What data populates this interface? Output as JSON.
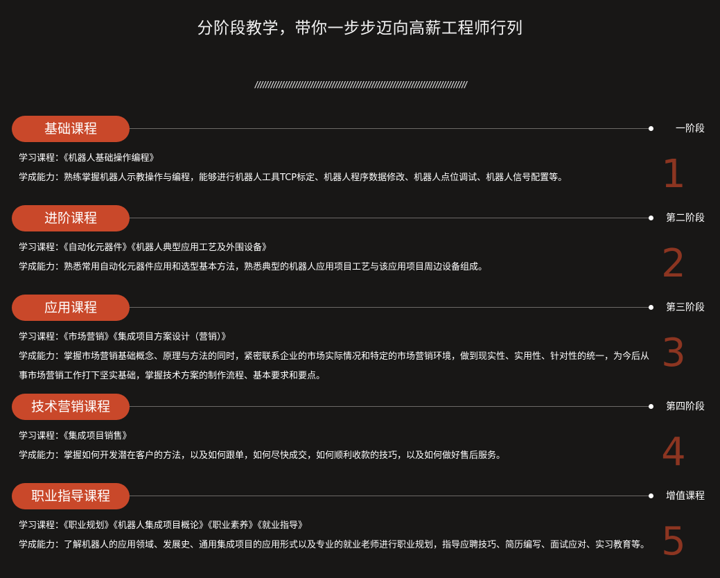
{
  "header": {
    "title": "分阶段教学，带你一步步迈向高薪工程师行列",
    "divider": "////////////////////////////////////////////////////////////////////////////////"
  },
  "labels": {
    "course": "学习课程：",
    "ability": "学成能力："
  },
  "stages": [
    {
      "name": "基础课程",
      "stage": "一阶段",
      "number": "1",
      "courses": "《机器人基础操作编程》",
      "ability": "熟练掌握机器人示教操作与编程，能够进行机器人工具TCP标定、机器人程序数据修改、机器人点位调试、机器人信号配置等。"
    },
    {
      "name": "进阶课程",
      "stage": "第二阶段",
      "number": "2",
      "courses": "《自动化元器件》《机器人典型应用工艺及外围设备》",
      "ability": "熟悉常用自动化元器件应用和选型基本方法，熟悉典型的机器人应用项目工艺与该应用项目周边设备组成。"
    },
    {
      "name": "应用课程",
      "stage": "第三阶段",
      "number": "3",
      "courses": "《市场营销》《集成项目方案设计（营销）》",
      "ability": "掌握市场营销基础概念、原理与方法的同时，紧密联系企业的市场实际情况和特定的市场营销环境，做到现实性、实用性、针对性的统一，为今后从事市场营销工作打下坚实基础，掌握技术方案的制作流程、基本要求和要点。"
    },
    {
      "name": "技术营销课程",
      "stage": "第四阶段",
      "number": "4",
      "courses": "《集成项目销售》",
      "ability": "掌握如何开发潜在客户的方法，以及如何跟单，如何尽快成交，如何顺利收款的技巧，以及如何做好售后服务。"
    },
    {
      "name": "职业指导课程",
      "stage": "增值课程",
      "number": "5",
      "courses": "《职业规划》《机器人集成项目概论》《职业素养》《就业指导》",
      "ability": "了解机器人的应用领域、发展史、通用集成项目的应用形式以及专业的就业老师进行职业规划，指导应聘技巧、简历编写、面试应对、实习教育等。"
    }
  ],
  "colors": {
    "background": "#181716",
    "accent": "#c9482a",
    "number": "#8c3521"
  }
}
